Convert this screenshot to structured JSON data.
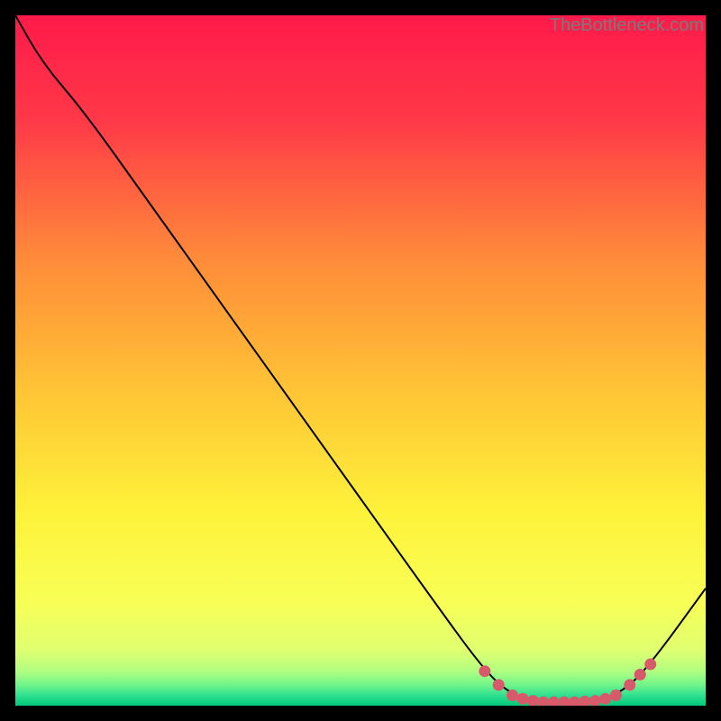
{
  "watermark": "TheBottleneck.com",
  "chart_data": {
    "type": "line",
    "title": "",
    "xlabel": "",
    "ylabel": "",
    "xlim": [
      0,
      100
    ],
    "ylim": [
      0,
      100
    ],
    "grid": false,
    "series": [
      {
        "name": "curve",
        "color": "#000000",
        "points": [
          {
            "x": 0,
            "y": 100
          },
          {
            "x": 4,
            "y": 93
          },
          {
            "x": 10,
            "y": 86
          },
          {
            "x": 20,
            "y": 72
          },
          {
            "x": 30,
            "y": 58
          },
          {
            "x": 40,
            "y": 44
          },
          {
            "x": 50,
            "y": 30
          },
          {
            "x": 60,
            "y": 16
          },
          {
            "x": 68,
            "y": 5
          },
          {
            "x": 72,
            "y": 1.5
          },
          {
            "x": 76,
            "y": 0.5
          },
          {
            "x": 80,
            "y": 0.5
          },
          {
            "x": 84,
            "y": 0.7
          },
          {
            "x": 88,
            "y": 2
          },
          {
            "x": 92,
            "y": 6
          },
          {
            "x": 100,
            "y": 17
          }
        ]
      }
    ],
    "markers": [
      {
        "x": 68,
        "y": 5,
        "color": "#d85a6a"
      },
      {
        "x": 70,
        "y": 3,
        "color": "#d85a6a"
      },
      {
        "x": 72,
        "y": 1.5,
        "color": "#d85a6a"
      },
      {
        "x": 73.5,
        "y": 1,
        "color": "#d85a6a"
      },
      {
        "x": 75,
        "y": 0.7,
        "color": "#d85a6a"
      },
      {
        "x": 76.5,
        "y": 0.5,
        "color": "#d85a6a"
      },
      {
        "x": 78,
        "y": 0.5,
        "color": "#d85a6a"
      },
      {
        "x": 79.5,
        "y": 0.5,
        "color": "#d85a6a"
      },
      {
        "x": 81,
        "y": 0.5,
        "color": "#d85a6a"
      },
      {
        "x": 82.5,
        "y": 0.6,
        "color": "#d85a6a"
      },
      {
        "x": 84,
        "y": 0.7,
        "color": "#d85a6a"
      },
      {
        "x": 85.5,
        "y": 1,
        "color": "#d85a6a"
      },
      {
        "x": 87,
        "y": 1.5,
        "color": "#d85a6a"
      },
      {
        "x": 89,
        "y": 3,
        "color": "#d85a6a"
      },
      {
        "x": 90.5,
        "y": 4.5,
        "color": "#d85a6a"
      },
      {
        "x": 92,
        "y": 6,
        "color": "#d85a6a"
      }
    ],
    "gradient_stops": [
      {
        "offset": 0,
        "color": "#ff1a4a"
      },
      {
        "offset": 15,
        "color": "#ff3848"
      },
      {
        "offset": 35,
        "color": "#ff8a3a"
      },
      {
        "offset": 55,
        "color": "#ffc635"
      },
      {
        "offset": 72,
        "color": "#fef23a"
      },
      {
        "offset": 85,
        "color": "#f8ff56"
      },
      {
        "offset": 92,
        "color": "#e0ff70"
      },
      {
        "offset": 95,
        "color": "#b0ff80"
      },
      {
        "offset": 97,
        "color": "#70f58a"
      },
      {
        "offset": 98.5,
        "color": "#30e090"
      },
      {
        "offset": 100,
        "color": "#00c878"
      }
    ]
  }
}
